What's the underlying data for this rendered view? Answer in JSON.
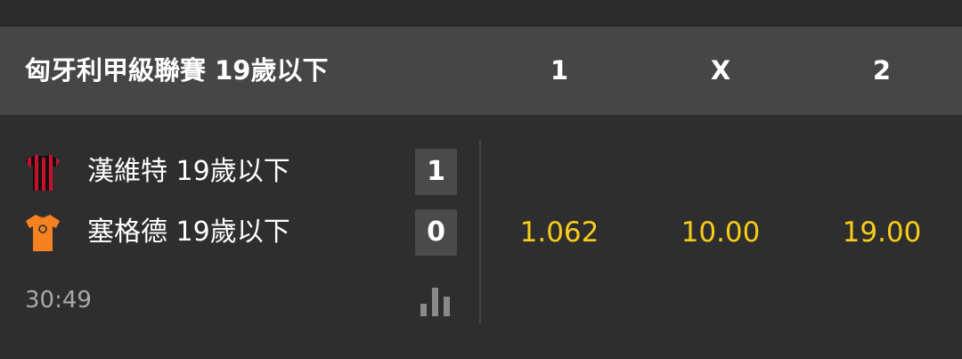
{
  "league": {
    "title": "匈牙利甲級聯賽 19歲以下",
    "col_home": "1",
    "col_draw": "X",
    "col_away": "2"
  },
  "event": {
    "home_team": {
      "name": "漢維特 19歲以下",
      "score": "1",
      "jersey_icon": "red-black-striped-jersey-icon",
      "colors": [
        "#c8102e",
        "#111111"
      ]
    },
    "away_team": {
      "name": "塞格德 19歲以下",
      "score": "0",
      "jersey_icon": "orange-jersey-icon",
      "colors": [
        "#f58220"
      ]
    },
    "time": "30:49",
    "stats_icon": "bar-chart-icon",
    "odds": {
      "home": "1.062",
      "draw": "10.00",
      "away": "19.00"
    }
  },
  "colors": {
    "odds_text": "#f7cc1c",
    "header_bg": "#464646",
    "body_bg": "#2e2e2e"
  }
}
